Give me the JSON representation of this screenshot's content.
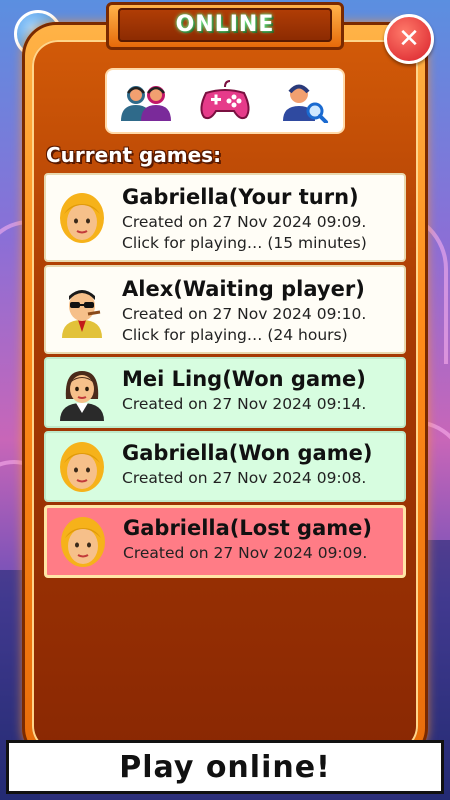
{
  "header": {
    "title": "ONLINE",
    "close_icon": "close-icon"
  },
  "tabs": [
    {
      "icon": "players-icon"
    },
    {
      "icon": "gamepad-icon"
    },
    {
      "icon": "search-player-icon"
    }
  ],
  "section_label": "Current games:",
  "games": [
    {
      "title": "Gabriella(Your turn)",
      "created": "Created on 27 Nov 2024 09:09.",
      "info": "Click for playing… (15 minutes)",
      "avatar": "woman-blonde-avatar",
      "status": "your-turn"
    },
    {
      "title": "Alex(Waiting player)",
      "created": "Created on 27 Nov 2024 09:10.",
      "info": "Click for playing… (24 hours)",
      "avatar": "man-sunglasses-avatar",
      "status": "waiting"
    },
    {
      "title": "Mei Ling(Won game)",
      "created": "Created on 27 Nov 2024 09:14.",
      "avatar": "woman-dark-hair-avatar",
      "status": "won"
    },
    {
      "title": "Gabriella(Won game)",
      "created": "Created on 27 Nov 2024 09:08.",
      "avatar": "woman-blonde-avatar",
      "status": "won"
    },
    {
      "title": "Gabriella(Lost game)",
      "created": "Created on 27 Nov 2024 09:09.",
      "avatar": "woman-blonde-avatar",
      "status": "lost"
    }
  ],
  "footer": {
    "label": "Play online!"
  },
  "colors": {
    "panel": "#c2490a",
    "won": "#d7fde0",
    "lost": "#ff7c86",
    "pending": "#fffdf6"
  }
}
